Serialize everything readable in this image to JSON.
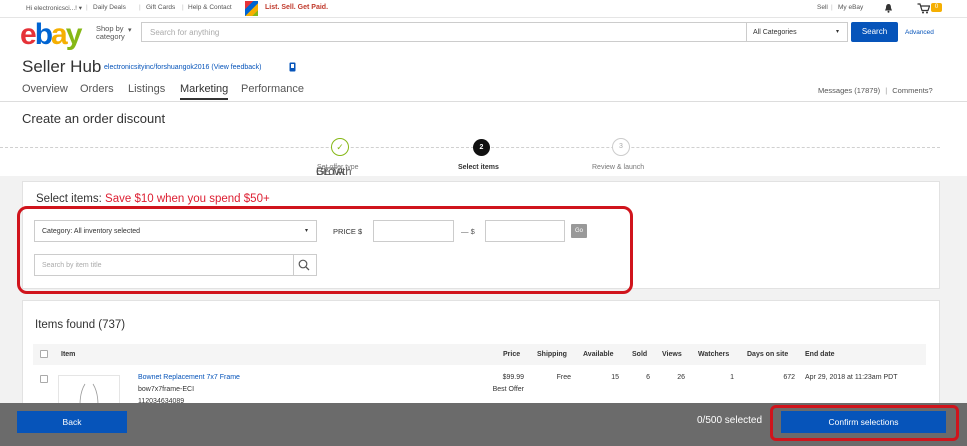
{
  "topbar": {
    "greeting": "Hi electronicsci...! ▾",
    "daily_deals": "Daily Deals",
    "gift_cards": "Gift Cards",
    "help_contact": "Help & Contact",
    "promo": "List. Sell. Get Paid.",
    "sell": "Sell",
    "my_ebay": "My eBay",
    "cart_count": "0"
  },
  "header": {
    "logo": [
      "e",
      "b",
      "a",
      "y"
    ],
    "shop_by": "Shop by",
    "category": "category",
    "search_placeholder": "Search for anything",
    "category_select": "All Categories",
    "search_button": "Search",
    "advanced": "Advanced"
  },
  "hub": {
    "title": "Seller Hub",
    "user": "electronicsityinc/forshuangok2016 (View feedback)",
    "nav": [
      "Overview",
      "Orders",
      "Listings",
      "Marketing",
      "Performance",
      "Growth"
    ],
    "beta": "BETA",
    "active_tab": "Marketing",
    "messages": "Messages (17879)",
    "comments": "Comments?"
  },
  "page": {
    "title": "Create an order discount"
  },
  "stepper": {
    "steps": [
      {
        "label": "Set offer type",
        "marker": "✓",
        "state": "done"
      },
      {
        "label": "Select items",
        "marker": "2",
        "state": "current"
      },
      {
        "label": "Review & launch",
        "marker": "3",
        "state": "upcoming"
      }
    ]
  },
  "filters": {
    "heading": "Select items:",
    "promo": "Save $10 when you spend $50+",
    "category_value": "Category: All inventory selected",
    "price_label": "PRICE",
    "currency": "$",
    "dash": "—",
    "go_label": "Go",
    "price_min": "",
    "price_max": "",
    "item_search_placeholder": "Search by item title"
  },
  "table": {
    "items_found": "Items found (737)",
    "columns": [
      "Item",
      "Price",
      "Shipping",
      "Available",
      "Sold",
      "Views",
      "Watchers",
      "Days on site",
      "End date"
    ],
    "rows": [
      {
        "title": "Bownet Replacement 7x7 Frame",
        "sku": "bow7x7frame-ECI",
        "item_id": "112034634089",
        "price": "$99.99",
        "format": "Best Offer",
        "shipping": "Free",
        "available": "15",
        "sold": "6",
        "views": "26",
        "watchers": "1",
        "days_on_site": "672",
        "end_date": "Apr 29, 2018 at 11:23am PDT"
      }
    ]
  },
  "footer": {
    "back": "Back",
    "selected": "0/500 selected",
    "confirm": "Confirm selections"
  },
  "colors": {
    "ebay_red": "#e53238",
    "ebay_blue": "#0064d2",
    "ebay_yellow": "#f5af02",
    "ebay_green": "#86b817",
    "primary_button": "#0654ba",
    "highlight_annotation": "#d0141c",
    "promo_text": "#dd1e31",
    "step_done": "#86b817"
  }
}
